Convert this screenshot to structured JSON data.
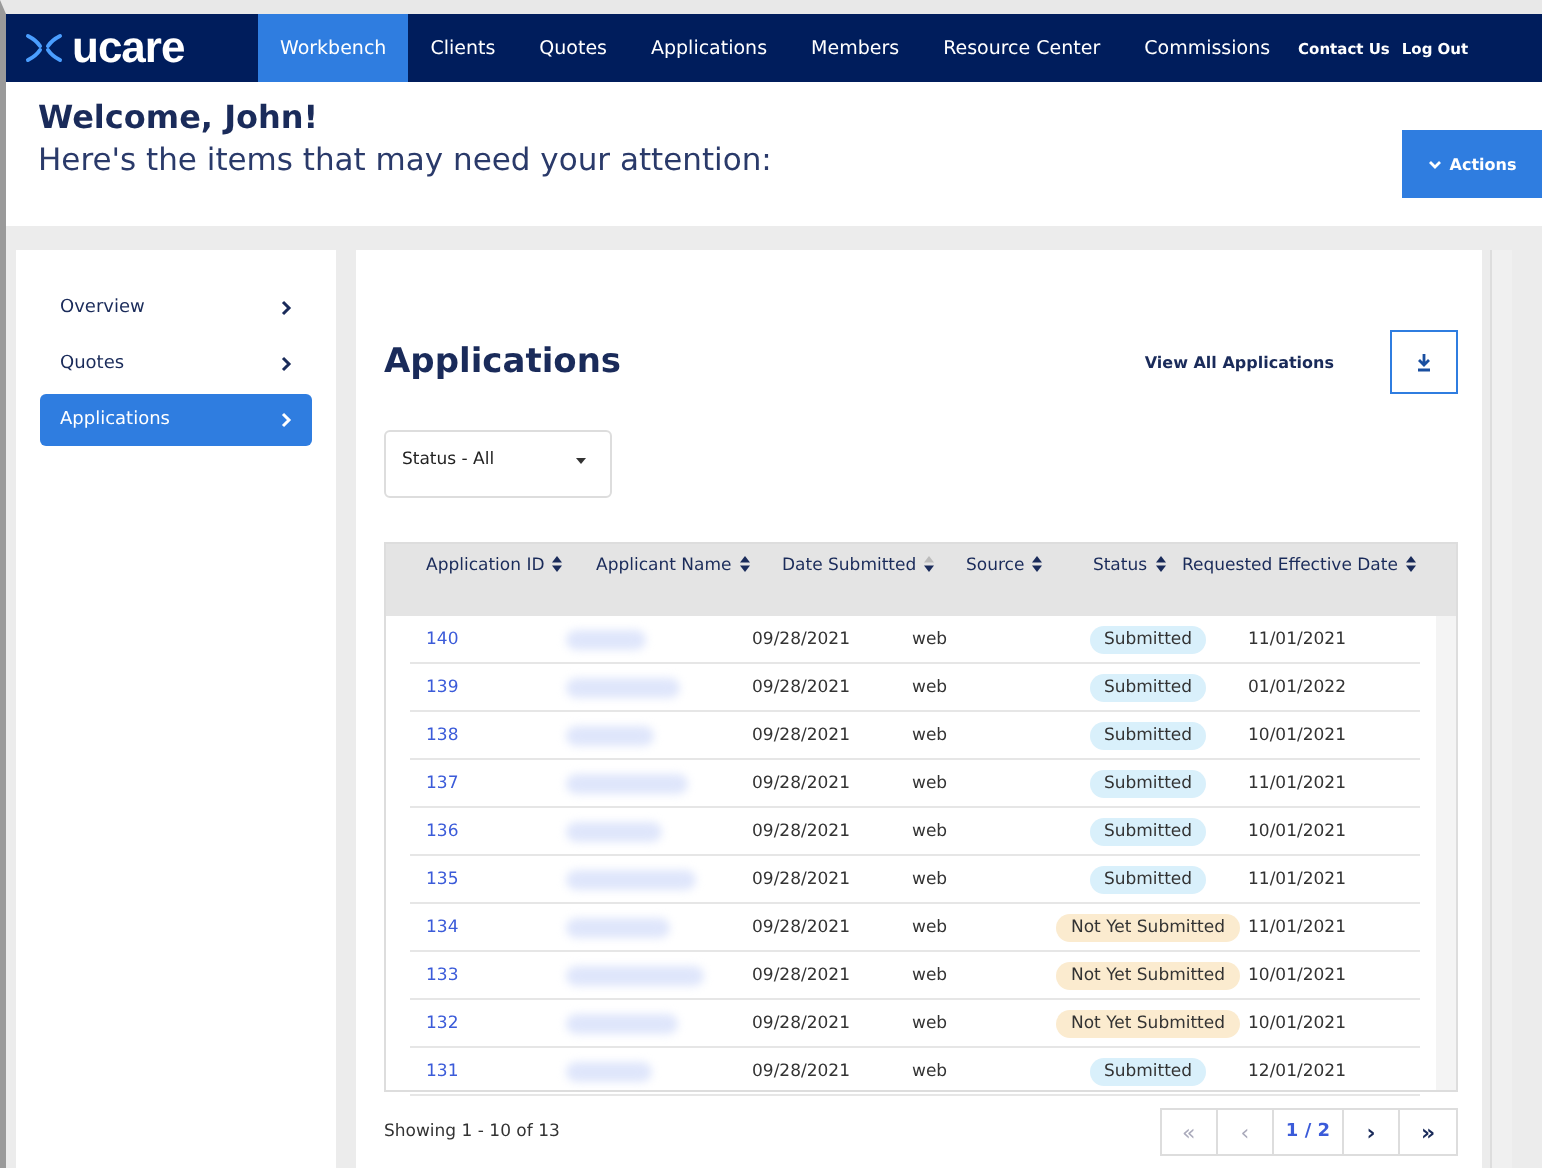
{
  "nav": {
    "logo": "ucare",
    "items": [
      {
        "label": "Workbench",
        "selected": true
      },
      {
        "label": "Clients",
        "selected": false
      },
      {
        "label": "Quotes",
        "selected": false
      },
      {
        "label": "Applications",
        "selected": false
      },
      {
        "label": "Members",
        "selected": false
      },
      {
        "label": "Resource Center",
        "selected": false
      },
      {
        "label": "Commissions",
        "selected": false
      }
    ],
    "links": [
      "Contact Us",
      "Log Out"
    ]
  },
  "header": {
    "greeting": "Welcome, John!",
    "subtitle": "Here's the items that may need your attention:",
    "actions_button": "Actions"
  },
  "sidebar": {
    "items": [
      {
        "label": "Overview",
        "selected": false
      },
      {
        "label": "Quotes",
        "selected": false
      },
      {
        "label": "Applications",
        "selected": true
      }
    ]
  },
  "panel": {
    "title": "Applications",
    "view_all": "View All Applications",
    "status_filter": "Status - All",
    "table": {
      "columns": [
        "Application ID",
        "Applicant Name",
        "Date Submitted",
        "Source",
        "Status",
        "Requested Effective Date"
      ],
      "rows": [
        {
          "id": "140",
          "date": "09/28/2021",
          "source": "web",
          "status": "Submitted",
          "kind": "submitted",
          "effective": "11/01/2021"
        },
        {
          "id": "139",
          "date": "09/28/2021",
          "source": "web",
          "status": "Submitted",
          "kind": "submitted",
          "effective": "01/01/2022"
        },
        {
          "id": "138",
          "date": "09/28/2021",
          "source": "web",
          "status": "Submitted",
          "kind": "submitted",
          "effective": "10/01/2021"
        },
        {
          "id": "137",
          "date": "09/28/2021",
          "source": "web",
          "status": "Submitted",
          "kind": "submitted",
          "effective": "11/01/2021"
        },
        {
          "id": "136",
          "date": "09/28/2021",
          "source": "web",
          "status": "Submitted",
          "kind": "submitted",
          "effective": "10/01/2021"
        },
        {
          "id": "135",
          "date": "09/28/2021",
          "source": "web",
          "status": "Submitted",
          "kind": "submitted",
          "effective": "11/01/2021"
        },
        {
          "id": "134",
          "date": "09/28/2021",
          "source": "web",
          "status": "Not Yet Submitted",
          "kind": "pending",
          "effective": "11/01/2021"
        },
        {
          "id": "133",
          "date": "09/28/2021",
          "source": "web",
          "status": "Not Yet Submitted",
          "kind": "pending",
          "effective": "10/01/2021"
        },
        {
          "id": "132",
          "date": "09/28/2021",
          "source": "web",
          "status": "Not Yet Submitted",
          "kind": "pending",
          "effective": "10/01/2021"
        },
        {
          "id": "131",
          "date": "09/28/2021",
          "source": "web",
          "status": "Submitted",
          "kind": "submitted",
          "effective": "12/01/2021"
        }
      ]
    },
    "showing": "Showing 1 - 10 of 13",
    "pagination": [
      {
        "label": "«",
        "kind": "first",
        "disabled": true
      },
      {
        "label": "‹",
        "kind": "prev",
        "disabled": true
      },
      {
        "label": "1 / 2",
        "kind": "page",
        "disabled": false
      },
      {
        "label": "›",
        "kind": "next",
        "disabled": false
      },
      {
        "label": "»",
        "kind": "last",
        "disabled": false
      }
    ]
  }
}
